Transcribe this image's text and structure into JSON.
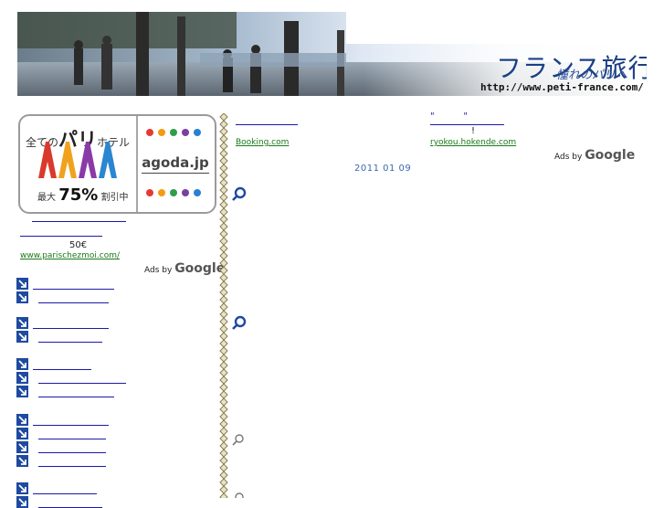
{
  "header": {
    "title": "フランス旅行",
    "subtitle": "憧れのパリへ",
    "url": "http://www.peti-france.com/"
  },
  "agoda_ad": {
    "line1_prefix": "全ての",
    "line1_big": "パリ",
    "line1_suffix": "ホテル",
    "line2_prefix": "最大",
    "line2_big": "75%",
    "line2_suffix": "割引中",
    "logo": "agoda.jp",
    "dot_colors": [
      "#e53935",
      "#f39c12",
      "#2e9e4b",
      "#7b3fa0",
      "#2a7fd4"
    ]
  },
  "sidebar": {
    "price": "50€",
    "url": "www.parischezmoi.com/",
    "ads_by": "Ads by",
    "ads_brand": "Google"
  },
  "main": {
    "ad1_url": "Booking.com",
    "ad2_quotes": "\"          \"",
    "ad2_exclaim": "!",
    "ad2_url": "ryokou.hokende.com",
    "ads_by": "Ads by",
    "ads_brand": "Google",
    "date": "2011 01 09"
  },
  "colors": {
    "link": "#1a1aa6",
    "ad_url_green": "#1a7a1a",
    "nav_icon": "#1e4aa0",
    "date": "#3a68b0"
  },
  "icons": [
    "arrow-icon",
    "magnifier-icon",
    "eiffel-tower-icon",
    "chain-divider"
  ]
}
